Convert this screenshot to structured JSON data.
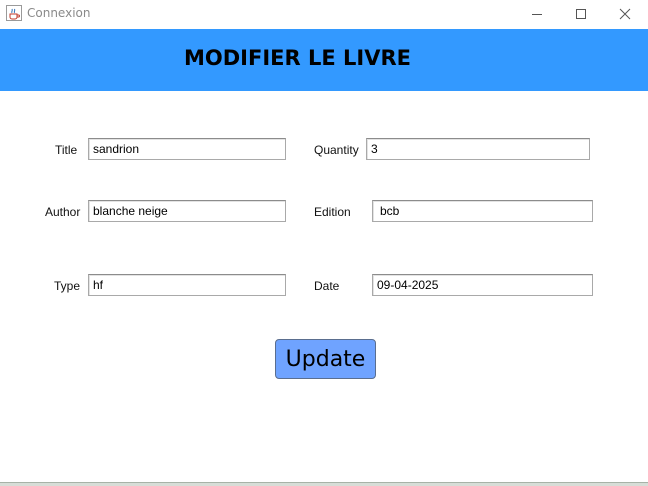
{
  "window": {
    "title": "Connexion",
    "icon": "java-cup-icon",
    "controls": {
      "minimize": "minimize-icon",
      "maximize": "maximize-icon",
      "close": "close-icon"
    }
  },
  "header": {
    "title": "MODIFIER LE LIVRE",
    "background": "#3399ff"
  },
  "form": {
    "title_label": "Title",
    "title_value": "sandrion",
    "author_label": "Author",
    "author_value": "blanche neige",
    "type_label": "Type",
    "type_value": "hf",
    "quantity_label": "Quantity",
    "quantity_value": "3",
    "edition_label": "Edition",
    "edition_value": "bcb",
    "date_label": "Date",
    "date_value": "09-04-2025"
  },
  "actions": {
    "update_label": "Update",
    "update_color": "#6fa3ff"
  }
}
